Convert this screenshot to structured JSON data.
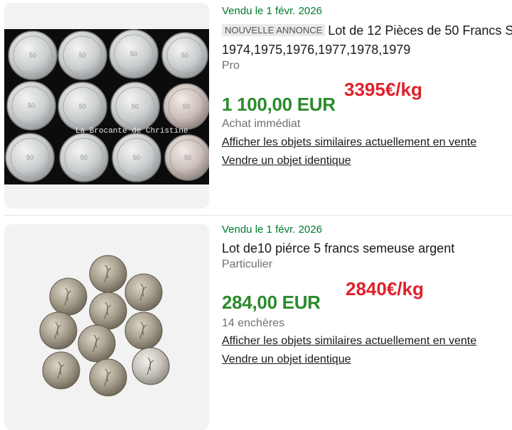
{
  "listings": [
    {
      "sold_date": "Vendu le 1 févr. 2026",
      "badge": "NOUVELLE ANNONCE",
      "title_line1": "Lot de 12 Pièces de 50 Francs S",
      "title_line2": "1974,1975,1976,1977,1978,1979",
      "seller_type": "Pro",
      "price": "1 100,00 EUR",
      "price_per_kg": "3395€/kg",
      "sale_type": "Achat immédiat",
      "link_similar": "Afficher les objets similaires actuellement en vente",
      "link_sell": "Vendre un objet identique",
      "watermark": "La Brocante de Christine"
    },
    {
      "sold_date": "Vendu le 1 févr. 2026",
      "title_line1": "Lot de10 piérce 5 francs semeuse argent",
      "seller_type": "Particulier",
      "price": "284,00 EUR",
      "price_per_kg": "2840€/kg",
      "sale_type": "14 enchères",
      "link_similar": "Afficher les objets similaires actuellement en vente",
      "link_sell": "Vendre un objet identique"
    }
  ]
}
